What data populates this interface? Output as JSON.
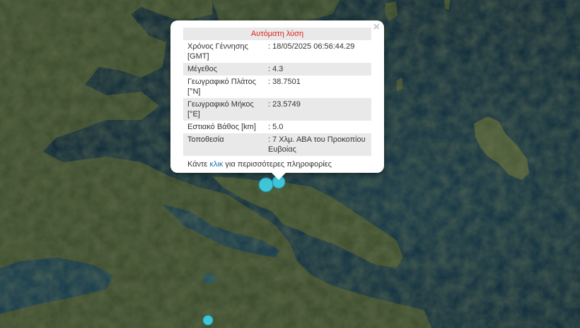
{
  "popup": {
    "title": "Αυτόματη λύση",
    "close_glyph": "×",
    "rows": [
      {
        "label": "Χρόνος Γέννησης [GMT]",
        "value": ": 18/05/2025 06:56:44.29"
      },
      {
        "label": "Μέγεθος",
        "value": ": 4.3"
      },
      {
        "label": "Γεωγραφικό Πλάτος [°N]",
        "value": ": 38.7501"
      },
      {
        "label": "Γεωγραφικό Μήκος [°E]",
        "value": ": 23.5749"
      },
      {
        "label": "Εστιακό Βάθος [km]",
        "value": ": 5.0"
      },
      {
        "label": "Τοποθεσία",
        "value": ": 7 Χλμ. ΑΒΑ του Προκοπίου Ευβοίας"
      }
    ],
    "footer_prefix": "Κάντε ",
    "footer_link": "κλικ",
    "footer_suffix": " για περισσότερες πληροφορίες"
  },
  "colors": {
    "sea": "#0d2a3c",
    "land": "#3b4a2a",
    "marker": "#3fc4d8",
    "title_red": "#e02020",
    "link_blue": "#1a6fb0"
  },
  "markers": [
    {
      "type": "earthquake-marker"
    },
    {
      "type": "earthquake-marker"
    },
    {
      "type": "earthquake-marker"
    }
  ]
}
